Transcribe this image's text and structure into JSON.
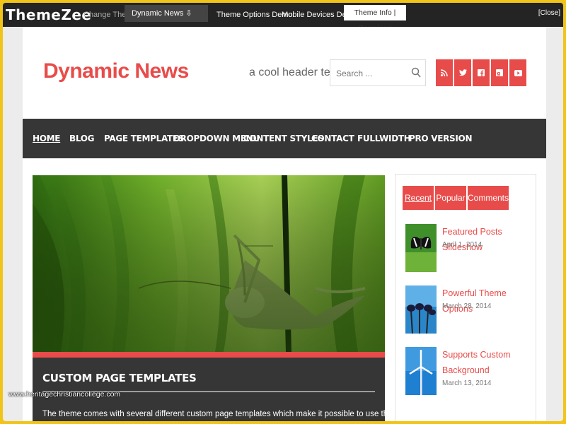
{
  "demo_bar": {
    "logo": "ThemeZee",
    "change_theme_label": "Change Theme:",
    "theme_select": "Dynamic News ⇩",
    "links": [
      "Theme Options Demo",
      "Mobile Devices Demo"
    ],
    "info_download": "Theme Info | Download",
    "close": "[Close]"
  },
  "header": {
    "site_title": "Dynamic News",
    "header_text": "a cool header text",
    "search_placeholder": "Search ...",
    "social_icons": [
      "rss-icon",
      "twitter-icon",
      "facebook-icon",
      "google-plus-icon",
      "youtube-icon"
    ]
  },
  "nav": {
    "items": [
      "HOME",
      "BLOG",
      "PAGE TEMPLATES",
      "DROPDOWN MENU",
      "CONTENT STYLES",
      "CONTACT",
      "FULLWIDTH",
      "PRO VERSION"
    ]
  },
  "featured": {
    "title": "CUSTOM PAGE TEMPLATES",
    "excerpt": "The theme comes with several different custom page templates which make it possible to use the theme as"
  },
  "watermark": "www.heritagechristiancollege.com",
  "sidebar": {
    "tabs": [
      "Recent",
      "Popular",
      "Comments"
    ],
    "posts": [
      {
        "title": "Featured Posts Slideshow",
        "date": "April 1, 2014",
        "thumb": "butterfly"
      },
      {
        "title": "Powerful Theme Options",
        "date": "March 28, 2014",
        "thumb": "flowers"
      },
      {
        "title": "Supports Custom Background",
        "date": "March 13, 2014",
        "thumb": "wind-turbine"
      }
    ]
  },
  "colors": {
    "accent": "#e84c4a",
    "dark": "#363636",
    "bar": "#242424",
    "frame": "#f0c419"
  }
}
